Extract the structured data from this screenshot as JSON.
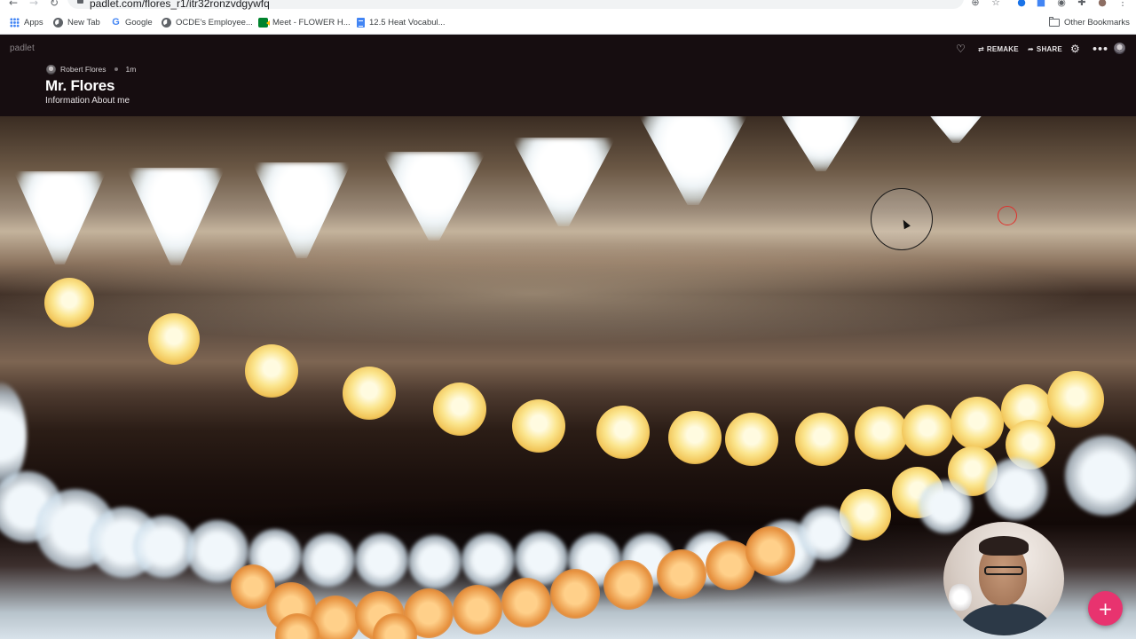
{
  "browser": {
    "url": "padlet.com/flores_r1/itr32ronzvdgywfq",
    "bookmarks": [
      {
        "label": "Apps",
        "icon": "apps-grid-icon"
      },
      {
        "label": "New Tab",
        "icon": "globe-icon"
      },
      {
        "label": "Google",
        "icon": "google-icon"
      },
      {
        "label": "OCDE's Employee...",
        "icon": "globe-icon"
      },
      {
        "label": "Meet - FLOWER H...",
        "icon": "meet-icon"
      },
      {
        "label": "12.5 Heat Vocabul...",
        "icon": "docs-icon"
      }
    ],
    "other_bookmarks": "Other Bookmarks"
  },
  "padlet": {
    "logo": "padlet",
    "author": "Robert Flores",
    "time_ago": "1m",
    "title": "Mr. Flores",
    "subtitle": "Information About me",
    "actions": {
      "remake_label": "REMAKE",
      "share_label": "SHARE"
    },
    "add_button_label": "+",
    "accent_color": "#e8336f",
    "header_bg": "#160d10"
  },
  "icons": {
    "heart": "♡",
    "remake": "⇄",
    "share": "➦",
    "gear": "⚙",
    "more": "•••",
    "back": "←",
    "forward": "→",
    "reload": "↻"
  }
}
